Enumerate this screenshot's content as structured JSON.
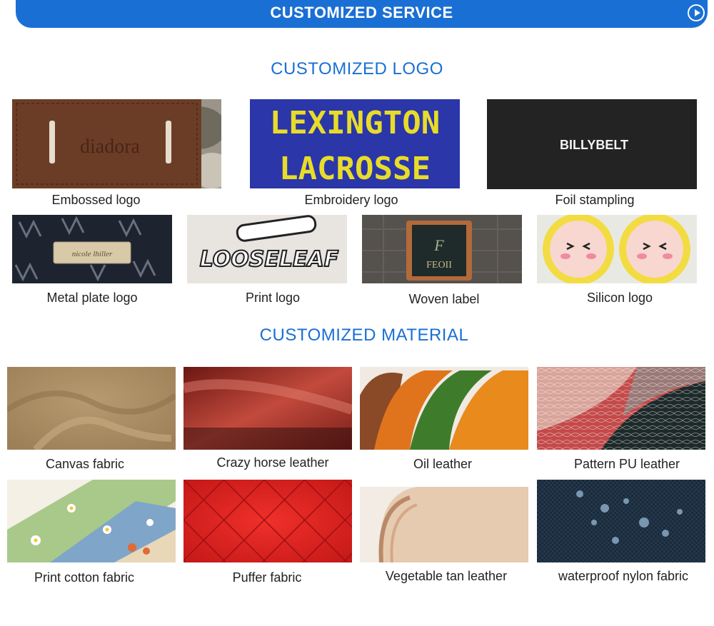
{
  "banner": {
    "title": "CUSTOMIZED SERVICE",
    "icon": "play-circle-icon"
  },
  "logo_section": {
    "title": "CUSTOMIZED LOGO",
    "items": [
      {
        "caption": "Embossed logo",
        "image_text": "diadora"
      },
      {
        "caption": "Embroidery logo",
        "image_text_line1": "LEXINGTON",
        "image_text_line2": "LACROSSE"
      },
      {
        "caption": "Foil stampling",
        "image_text": "BILLYBELT"
      },
      {
        "caption": "Metal plate logo"
      },
      {
        "caption": "Print logo",
        "image_text": "LOOSELEAF"
      },
      {
        "caption": "Woven label",
        "image_text": "FEOII"
      },
      {
        "caption": "Silicon logo"
      }
    ]
  },
  "material_section": {
    "title": "CUSTOMIZED MATERIAL",
    "items": [
      {
        "caption": "Canvas fabric"
      },
      {
        "caption": "Crazy horse leather"
      },
      {
        "caption": "Oil leather"
      },
      {
        "caption": "Pattern PU leather"
      },
      {
        "caption": "Print cotton fabric"
      },
      {
        "caption": "Puffer fabric"
      },
      {
        "caption": "Vegetable tan leather"
      },
      {
        "caption": "waterproof nylon fabric"
      }
    ]
  },
  "colors": {
    "accent": "#1a6fd4",
    "text": "#222222"
  }
}
